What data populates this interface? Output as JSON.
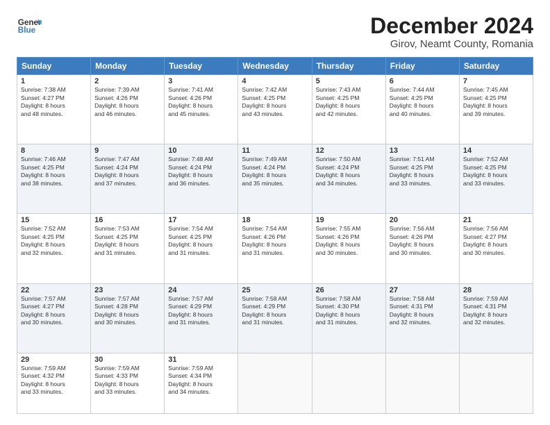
{
  "header": {
    "logo": {
      "line1": "General",
      "line2": "Blue"
    },
    "title": "December 2024",
    "subtitle": "Girov, Neamt County, Romania"
  },
  "columns": [
    "Sunday",
    "Monday",
    "Tuesday",
    "Wednesday",
    "Thursday",
    "Friday",
    "Saturday"
  ],
  "weeks": [
    [
      {
        "day": "1",
        "lines": [
          "Sunrise: 7:38 AM",
          "Sunset: 4:27 PM",
          "Daylight: 8 hours",
          "and 48 minutes."
        ]
      },
      {
        "day": "2",
        "lines": [
          "Sunrise: 7:39 AM",
          "Sunset: 4:26 PM",
          "Daylight: 8 hours",
          "and 46 minutes."
        ]
      },
      {
        "day": "3",
        "lines": [
          "Sunrise: 7:41 AM",
          "Sunset: 4:26 PM",
          "Daylight: 8 hours",
          "and 45 minutes."
        ]
      },
      {
        "day": "4",
        "lines": [
          "Sunrise: 7:42 AM",
          "Sunset: 4:25 PM",
          "Daylight: 8 hours",
          "and 43 minutes."
        ]
      },
      {
        "day": "5",
        "lines": [
          "Sunrise: 7:43 AM",
          "Sunset: 4:25 PM",
          "Daylight: 8 hours",
          "and 42 minutes."
        ]
      },
      {
        "day": "6",
        "lines": [
          "Sunrise: 7:44 AM",
          "Sunset: 4:25 PM",
          "Daylight: 8 hours",
          "and 40 minutes."
        ]
      },
      {
        "day": "7",
        "lines": [
          "Sunrise: 7:45 AM",
          "Sunset: 4:25 PM",
          "Daylight: 8 hours",
          "and 39 minutes."
        ]
      }
    ],
    [
      {
        "day": "8",
        "lines": [
          "Sunrise: 7:46 AM",
          "Sunset: 4:25 PM",
          "Daylight: 8 hours",
          "and 38 minutes."
        ]
      },
      {
        "day": "9",
        "lines": [
          "Sunrise: 7:47 AM",
          "Sunset: 4:24 PM",
          "Daylight: 8 hours",
          "and 37 minutes."
        ]
      },
      {
        "day": "10",
        "lines": [
          "Sunrise: 7:48 AM",
          "Sunset: 4:24 PM",
          "Daylight: 8 hours",
          "and 36 minutes."
        ]
      },
      {
        "day": "11",
        "lines": [
          "Sunrise: 7:49 AM",
          "Sunset: 4:24 PM",
          "Daylight: 8 hours",
          "and 35 minutes."
        ]
      },
      {
        "day": "12",
        "lines": [
          "Sunrise: 7:50 AM",
          "Sunset: 4:24 PM",
          "Daylight: 8 hours",
          "and 34 minutes."
        ]
      },
      {
        "day": "13",
        "lines": [
          "Sunrise: 7:51 AM",
          "Sunset: 4:25 PM",
          "Daylight: 8 hours",
          "and 33 minutes."
        ]
      },
      {
        "day": "14",
        "lines": [
          "Sunrise: 7:52 AM",
          "Sunset: 4:25 PM",
          "Daylight: 8 hours",
          "and 33 minutes."
        ]
      }
    ],
    [
      {
        "day": "15",
        "lines": [
          "Sunrise: 7:52 AM",
          "Sunset: 4:25 PM",
          "Daylight: 8 hours",
          "and 32 minutes."
        ]
      },
      {
        "day": "16",
        "lines": [
          "Sunrise: 7:53 AM",
          "Sunset: 4:25 PM",
          "Daylight: 8 hours",
          "and 31 minutes."
        ]
      },
      {
        "day": "17",
        "lines": [
          "Sunrise: 7:54 AM",
          "Sunset: 4:25 PM",
          "Daylight: 8 hours",
          "and 31 minutes."
        ]
      },
      {
        "day": "18",
        "lines": [
          "Sunrise: 7:54 AM",
          "Sunset: 4:26 PM",
          "Daylight: 8 hours",
          "and 31 minutes."
        ]
      },
      {
        "day": "19",
        "lines": [
          "Sunrise: 7:55 AM",
          "Sunset: 4:26 PM",
          "Daylight: 8 hours",
          "and 30 minutes."
        ]
      },
      {
        "day": "20",
        "lines": [
          "Sunrise: 7:56 AM",
          "Sunset: 4:26 PM",
          "Daylight: 8 hours",
          "and 30 minutes."
        ]
      },
      {
        "day": "21",
        "lines": [
          "Sunrise: 7:56 AM",
          "Sunset: 4:27 PM",
          "Daylight: 8 hours",
          "and 30 minutes."
        ]
      }
    ],
    [
      {
        "day": "22",
        "lines": [
          "Sunrise: 7:57 AM",
          "Sunset: 4:27 PM",
          "Daylight: 8 hours",
          "and 30 minutes."
        ]
      },
      {
        "day": "23",
        "lines": [
          "Sunrise: 7:57 AM",
          "Sunset: 4:28 PM",
          "Daylight: 8 hours",
          "and 30 minutes."
        ]
      },
      {
        "day": "24",
        "lines": [
          "Sunrise: 7:57 AM",
          "Sunset: 4:29 PM",
          "Daylight: 8 hours",
          "and 31 minutes."
        ]
      },
      {
        "day": "25",
        "lines": [
          "Sunrise: 7:58 AM",
          "Sunset: 4:29 PM",
          "Daylight: 8 hours",
          "and 31 minutes."
        ]
      },
      {
        "day": "26",
        "lines": [
          "Sunrise: 7:58 AM",
          "Sunset: 4:30 PM",
          "Daylight: 8 hours",
          "and 31 minutes."
        ]
      },
      {
        "day": "27",
        "lines": [
          "Sunrise: 7:58 AM",
          "Sunset: 4:31 PM",
          "Daylight: 8 hours",
          "and 32 minutes."
        ]
      },
      {
        "day": "28",
        "lines": [
          "Sunrise: 7:59 AM",
          "Sunset: 4:31 PM",
          "Daylight: 8 hours",
          "and 32 minutes."
        ]
      }
    ],
    [
      {
        "day": "29",
        "lines": [
          "Sunrise: 7:59 AM",
          "Sunset: 4:32 PM",
          "Daylight: 8 hours",
          "and 33 minutes."
        ]
      },
      {
        "day": "30",
        "lines": [
          "Sunrise: 7:59 AM",
          "Sunset: 4:33 PM",
          "Daylight: 8 hours",
          "and 33 minutes."
        ]
      },
      {
        "day": "31",
        "lines": [
          "Sunrise: 7:59 AM",
          "Sunset: 4:34 PM",
          "Daylight: 8 hours",
          "and 34 minutes."
        ]
      },
      {
        "day": "",
        "lines": []
      },
      {
        "day": "",
        "lines": []
      },
      {
        "day": "",
        "lines": []
      },
      {
        "day": "",
        "lines": []
      }
    ]
  ]
}
